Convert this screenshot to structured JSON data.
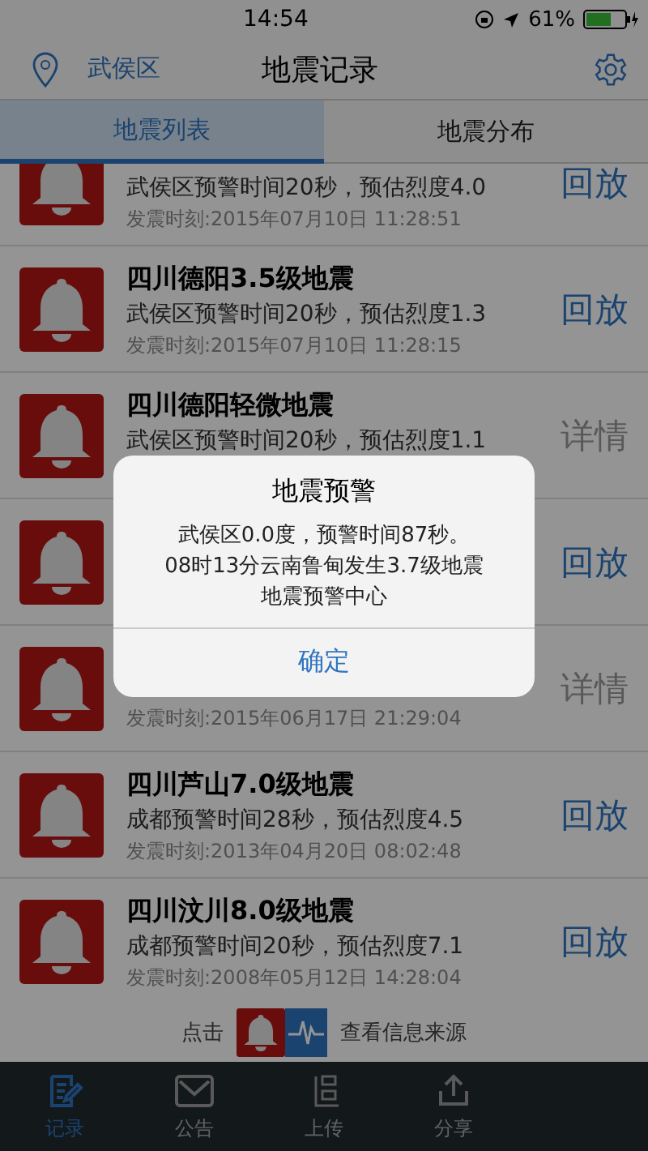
{
  "status_bar": {
    "time": "14:54",
    "battery_text": "61%"
  },
  "nav": {
    "location": "武侯区",
    "title": "地震记录"
  },
  "segments": [
    {
      "label": "地震列表",
      "selected": true
    },
    {
      "label": "地震分布",
      "selected": false
    }
  ],
  "records": [
    {
      "subtitle": "武侯区预警时间20秒，预估烈度4.0",
      "time": "发震时刻:2015年07月10日 11:28:51",
      "action": "回放",
      "kind": "replay"
    },
    {
      "title": "四川德阳3.5级地震",
      "subtitle": "武侯区预警时间20秒，预估烈度1.3",
      "time": "发震时刻:2015年07月10日 11:28:15",
      "action": "回放",
      "kind": "replay"
    },
    {
      "title": "四川德阳轻微地震",
      "subtitle": "武侯区预警时间20秒，预估烈度1.1",
      "action": "详情",
      "kind": "detail"
    },
    {
      "action": "回放",
      "kind": "replay"
    },
    {
      "time": "发震时刻:2015年06月17日 21:29:04",
      "action": "详情",
      "kind": "detail"
    },
    {
      "title": "四川芦山7.0级地震",
      "subtitle": "成都预警时间28秒，预估烈度4.5",
      "time": "发震时刻:2013年04月20日 08:02:48",
      "action": "回放",
      "kind": "replay"
    },
    {
      "title": "四川汶川8.0级地震",
      "subtitle": "成都预警时间20秒，预估烈度7.1",
      "time": "发震时刻:2008年05月12日 14:28:04",
      "action": "回放",
      "kind": "replay"
    }
  ],
  "footer": {
    "before": "点击",
    "after": "查看信息来源"
  },
  "tab_bar": [
    {
      "label": "记录",
      "selected": true
    },
    {
      "label": "公告",
      "selected": false
    },
    {
      "label": "上传",
      "selected": false
    },
    {
      "label": "分享",
      "selected": false
    }
  ],
  "alert": {
    "title": "地震预警",
    "lines": [
      "武侯区0.0度，预警时间87秒。",
      "08时13分云南鲁甸发生3.7级地震",
      "地震预警中心"
    ],
    "button": "确定"
  }
}
